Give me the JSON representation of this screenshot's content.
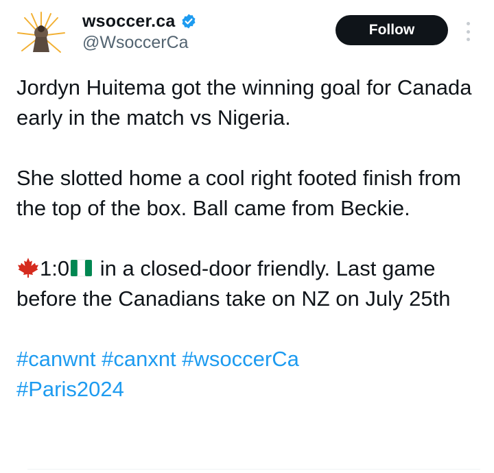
{
  "account": {
    "display_name": "wsoccer.ca",
    "handle": "@WsoccerCa",
    "verified": true,
    "avatar_icon": "soccer-player-sunburst-avatar"
  },
  "actions": {
    "follow_label": "Follow",
    "more_icon": "more-vertical-icon"
  },
  "tweet": {
    "para1": "Jordyn Huitema got the winning goal for Canada early in the match vs Nigeria.",
    "para2": "She slotted home a cool right footed finish from the top of the box. Ball came from Beckie.",
    "score": "1:0",
    "score_flags": {
      "home": "canada-maple-leaf-emoji",
      "away": "nigeria-flag-emoji"
    },
    "para3_rest": " in a closed-door friendly. Last game before the Canadians take on NZ on July 25th",
    "hashtags": [
      "#canwnt",
      "#canxnt",
      "#wsoccerCa",
      "#Paris2024"
    ]
  },
  "colors": {
    "link": "#1d9bf0",
    "text": "#0f1419",
    "secondary": "#536471",
    "verified": "#1d9bf0",
    "follow_bg": "#0f1419"
  }
}
